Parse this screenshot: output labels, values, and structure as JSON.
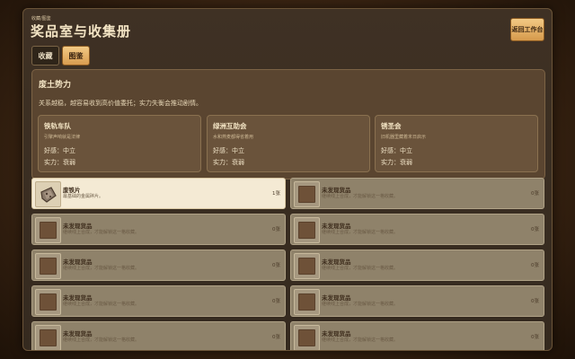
{
  "header": {
    "subtitle": "收藏/图鉴",
    "title": "奖品室与收集册",
    "back_label": "返回工作台"
  },
  "tabs": [
    {
      "label": "收藏",
      "active": false
    },
    {
      "label": "图鉴",
      "active": true
    }
  ],
  "faction": {
    "name": "废土势力",
    "description": "关系越稳，越容易收到高价值委托；实力失衡会推动剧情。",
    "groups": [
      {
        "name": "铁轨车队",
        "motto": "引擎声响就是法律",
        "affinity": "好感：中立",
        "strength": "实力：衰弱"
      },
      {
        "name": "绿洲互助会",
        "motto": "水和燕麦都得省着用",
        "affinity": "好感：中立",
        "strength": "实力：衰弱"
      },
      {
        "name": "锈圣会",
        "motto": "旧机器里藏着末日启示",
        "affinity": "好感：中立",
        "strength": "实力：衰弱"
      }
    ]
  },
  "items": [
    {
      "name": "废铁片",
      "desc": "最基础的金属碎片。",
      "count": "1张",
      "found": true
    },
    {
      "name": "未发现货品",
      "desc": "继续线上合成，才能解锁这一格收藏。",
      "count": "0张",
      "found": false
    },
    {
      "name": "未发现货品",
      "desc": "继续线上合成，才能解锁这一格收藏。",
      "count": "0张",
      "found": false
    },
    {
      "name": "未发现货品",
      "desc": "继续线上合成，才能解锁这一格收藏。",
      "count": "0张",
      "found": false
    },
    {
      "name": "未发现货品",
      "desc": "继续线上合成，才能解锁这一格收藏。",
      "count": "0张",
      "found": false
    },
    {
      "name": "未发现货品",
      "desc": "继续线上合成，才能解锁这一格收藏。",
      "count": "0张",
      "found": false
    },
    {
      "name": "未发现货品",
      "desc": "继续线上合成，才能解锁这一格收藏。",
      "count": "0张",
      "found": false
    },
    {
      "name": "未发现货品",
      "desc": "继续线上合成，才能解锁这一格收藏。",
      "count": "0张",
      "found": false
    },
    {
      "name": "未发现货品",
      "desc": "继续线上合成，才能解锁这一格收藏。",
      "count": "0张",
      "found": false
    },
    {
      "name": "未发现货品",
      "desc": "继续线上合成，才能解锁这一格收藏。",
      "count": "0张",
      "found": false
    }
  ]
}
